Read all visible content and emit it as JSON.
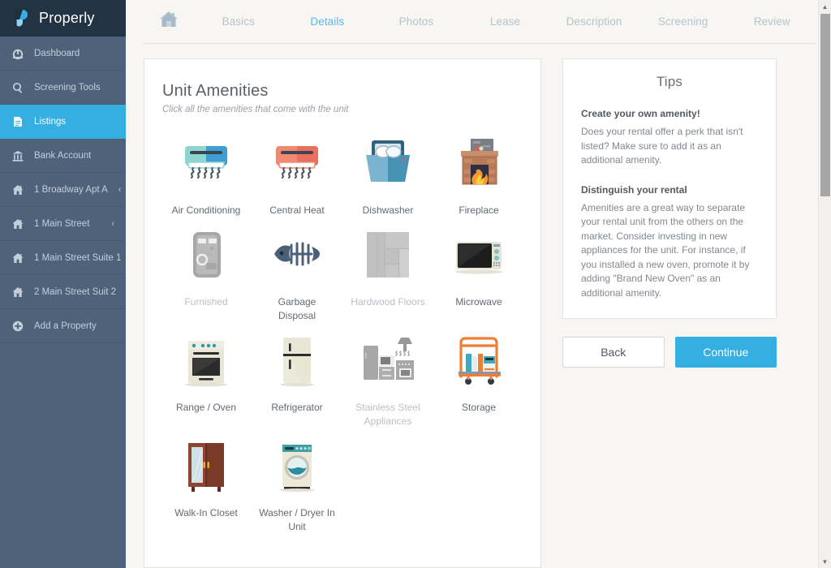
{
  "brand": {
    "name": "Properly",
    "logo_icon": "properly-logo-icon"
  },
  "sidebar": {
    "items": [
      {
        "label": "Dashboard",
        "icon": "dashboard-icon",
        "active": false,
        "caret": ""
      },
      {
        "label": "Screening Tools",
        "icon": "search-icon",
        "active": false,
        "caret": ""
      },
      {
        "label": "Listings",
        "icon": "document-icon",
        "active": true,
        "caret": ""
      },
      {
        "label": "Bank Account",
        "icon": "bank-icon",
        "active": false,
        "caret": ""
      },
      {
        "label": "1 Broadway Apt A",
        "icon": "home-icon",
        "active": false,
        "caret": "‹"
      },
      {
        "label": "1 Main Street",
        "icon": "home-icon",
        "active": false,
        "caret": "‹"
      },
      {
        "label": "1 Main Street Suite 1",
        "icon": "home-icon",
        "active": false,
        "caret": "‹"
      },
      {
        "label": "2 Main Street Suit 2",
        "icon": "home-icon",
        "active": false,
        "caret": "‹"
      },
      {
        "label": "Add a Property",
        "icon": "plus-circle-icon",
        "active": false,
        "caret": ""
      }
    ]
  },
  "tabs": {
    "home_icon": "home-icon",
    "items": [
      {
        "label": "Basics",
        "active": false
      },
      {
        "label": "Details",
        "active": true
      },
      {
        "label": "Photos",
        "active": false
      },
      {
        "label": "Lease",
        "active": false
      },
      {
        "label": "Description",
        "active": false
      },
      {
        "label": "Screening",
        "active": false
      },
      {
        "label": "Review",
        "active": false
      }
    ]
  },
  "amenities_card": {
    "title": "Unit Amenities",
    "subtitle": "Click all the amenities that come with the unit",
    "items": [
      {
        "label": "Air Conditioning",
        "icon": "air-conditioner-icon",
        "selected": true
      },
      {
        "label": "Central Heat",
        "icon": "central-heat-icon",
        "selected": true
      },
      {
        "label": "Dishwasher",
        "icon": "dishwasher-icon",
        "selected": true
      },
      {
        "label": "Fireplace",
        "icon": "fireplace-icon",
        "selected": true
      },
      {
        "label": "Furnished",
        "icon": "furnished-icon",
        "selected": false
      },
      {
        "label": "Garbage Disposal",
        "icon": "fish-bone-icon",
        "selected": true
      },
      {
        "label": "Hardwood Floors",
        "icon": "hardwood-floors-icon",
        "selected": false
      },
      {
        "label": "Microwave",
        "icon": "microwave-icon",
        "selected": true
      },
      {
        "label": "Range / Oven",
        "icon": "oven-icon",
        "selected": true
      },
      {
        "label": "Refrigerator",
        "icon": "refrigerator-icon",
        "selected": true
      },
      {
        "label": "Stainless Steel Appliances",
        "icon": "stainless-appliances-icon",
        "selected": false
      },
      {
        "label": "Storage",
        "icon": "luggage-cart-icon",
        "selected": true
      },
      {
        "label": "Walk-In Closet",
        "icon": "wardrobe-icon",
        "selected": true
      },
      {
        "label": "Washer / Dryer In Unit",
        "icon": "washing-machine-icon",
        "selected": true
      }
    ]
  },
  "tips": {
    "title": "Tips",
    "sections": [
      {
        "heading": "Create your own amenity!",
        "body": "Does your rental offer a perk that isn't listed? Make sure to add it as an additional amenity."
      },
      {
        "heading": "Distinguish your rental",
        "body": "Amenities are a great way to separate your rental unit from the others on the market. Consider investing in new appliances for the unit. For instance, if you installed a new oven, promote it by adding \"Brand New Oven\" as an additional amenity."
      }
    ]
  },
  "actions": {
    "back_label": "Back",
    "continue_label": "Continue"
  },
  "scrollbar": {
    "up_arrow": "▲",
    "down_arrow": "▼"
  },
  "colors": {
    "brand_dark": "#223344",
    "sidebar": "#4e6379",
    "accent": "#35aee2",
    "tab_active": "#57b9ef",
    "page_bg": "#f7f6f3"
  }
}
